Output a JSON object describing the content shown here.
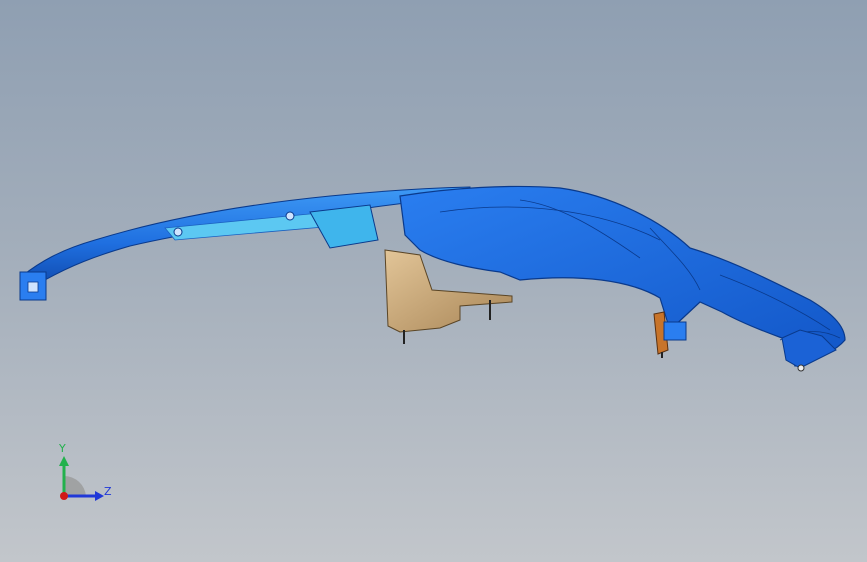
{
  "viewport": {
    "background_top": "#8f9fb2",
    "background_bottom": "#c2c6cb"
  },
  "model": {
    "part_color": "#1f6fe0",
    "part_highlight": "#3e9af5",
    "part_shadow": "#0b3f9e",
    "bracket_color": "#c9a878",
    "clip_color": "#c8742a"
  },
  "triad": {
    "y_label": "Y",
    "z_label": "Z",
    "y_color": "#22b14c",
    "z_color": "#2038d8",
    "x_color": "#d01818"
  }
}
